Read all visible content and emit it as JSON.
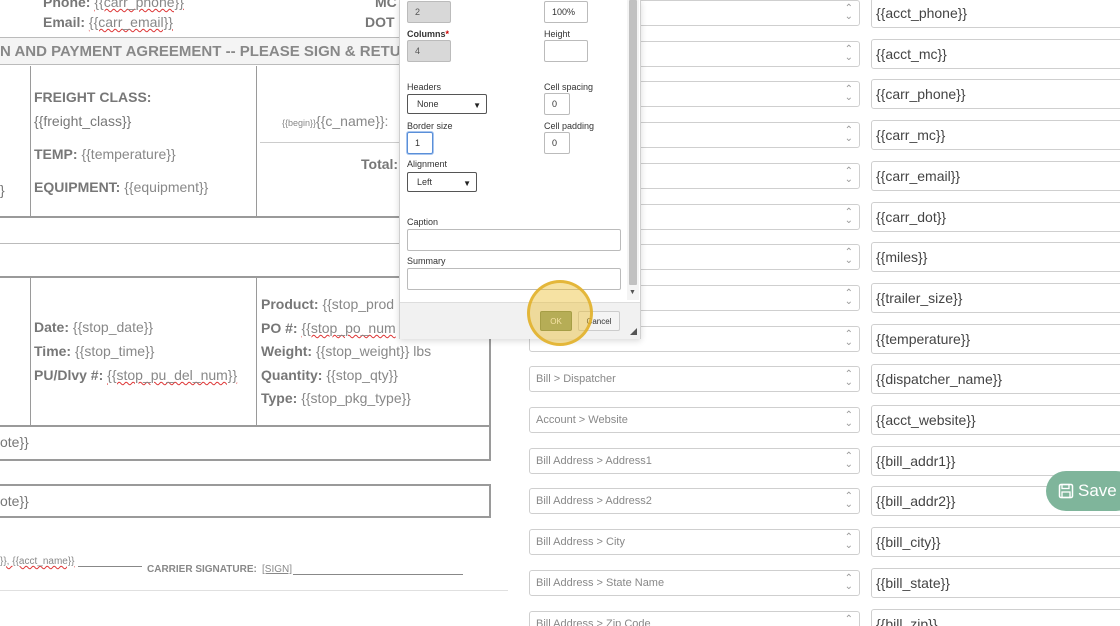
{
  "document": {
    "top_phone_label": "Phone:",
    "top_phone_var": "{{carr_phone}}",
    "top_email_label": "Email:",
    "top_email_var": "{{carr_email}}",
    "top_mc": "MC",
    "top_dot": "DOT",
    "agreement_heading": "N AND PAYMENT AGREEMENT -- PLEASE SIGN & RETURN",
    "freight_class_label": "FREIGHT CLASS:",
    "freight_class_var": "{{freight_class}}",
    "temp_label": "TEMP:",
    "temp_var": "{{temperature}}",
    "equipment_label": "EQUIPMENT:",
    "equipment_var": "{{equipment}}",
    "begin_tag": "{{begin}}",
    "c_name_var": "{{c_name}}: ",
    "total_label": "Total:",
    "left_stub": "}",
    "date_label": "Date:",
    "date_var": "{{stop_date}}",
    "time_label": "Time:",
    "time_var": "{{stop_time}}",
    "pudlvy_label": "PU/Dlvy #:",
    "pudlvy_var": "{{stop_pu_del_num}}",
    "product_label": "Product:",
    "product_var": "{{stop_prod",
    "po_label": "PO #:",
    "po_var": "{{stop_po_num",
    "weight_label": "Weight:",
    "weight_var": "{{stop_weight}} lbs",
    "quantity_label": "Quantity:",
    "quantity_var": "{{stop_qty}}",
    "type_label": "Type:",
    "type_var": "{{stop_pkg_type}}",
    "note1": "ote}}",
    "note2": "ote}}",
    "sig_left": "}}, {{acct_name}}",
    "carrier_sig_label": "CARRIER SIGNATURE:",
    "carrier_sig_var": "[SIGN]"
  },
  "dialog": {
    "rows_value": "2",
    "width_value": "100%",
    "columns_label": "Columns",
    "columns_required": "*",
    "columns_value": "4",
    "height_label": "Height",
    "height_value": "",
    "headers_label": "Headers",
    "headers_value": "None",
    "cell_spacing_label": "Cell spacing",
    "cell_spacing_value": "0",
    "border_size_label": "Border size",
    "border_size_value": "1",
    "cell_padding_label": "Cell padding",
    "cell_padding_value": "0",
    "alignment_label": "Alignment",
    "alignment_value": "Left",
    "caption_label": "Caption",
    "caption_value": "",
    "summary_label": "Summary",
    "summary_value": "",
    "ok_label": "OK",
    "cancel_label": "Cancel"
  },
  "mappings": [
    {
      "field": "",
      "value": "{{acct_phone}}"
    },
    {
      "field": "",
      "value": "{{acct_mc}}"
    },
    {
      "field": "",
      "value": "{{carr_phone}}"
    },
    {
      "field": "",
      "value": "{{carr_mc}}"
    },
    {
      "field": "",
      "value": "{{carr_email}}"
    },
    {
      "field": "",
      "value": "{{carr_dot}}"
    },
    {
      "field": "",
      "value": "{{miles}}"
    },
    {
      "field": "",
      "value": "{{trailer_size}}"
    },
    {
      "field": "",
      "value": "{{temperature}}"
    },
    {
      "field": "Bill > Dispatcher",
      "value": "{{dispatcher_name}}"
    },
    {
      "field": "Account > Website",
      "value": "{{acct_website}}"
    },
    {
      "field": "Bill Address > Address1",
      "value": "{{bill_addr1}}"
    },
    {
      "field": "Bill Address > Address2",
      "value": "{{bill_addr2}}"
    },
    {
      "field": "Bill Address > City",
      "value": "{{bill_city}}"
    },
    {
      "field": "Bill Address > State Name",
      "value": "{{bill_state}}"
    },
    {
      "field": "Bill Address > Zip Code",
      "value": "{{bill_zip}}"
    }
  ],
  "save_button": {
    "label": "Save",
    "icon": "floppy-disk-icon"
  },
  "colors": {
    "save": "#7fb59b",
    "ok": "#8a9f74",
    "highlight": "#ebbe32"
  }
}
